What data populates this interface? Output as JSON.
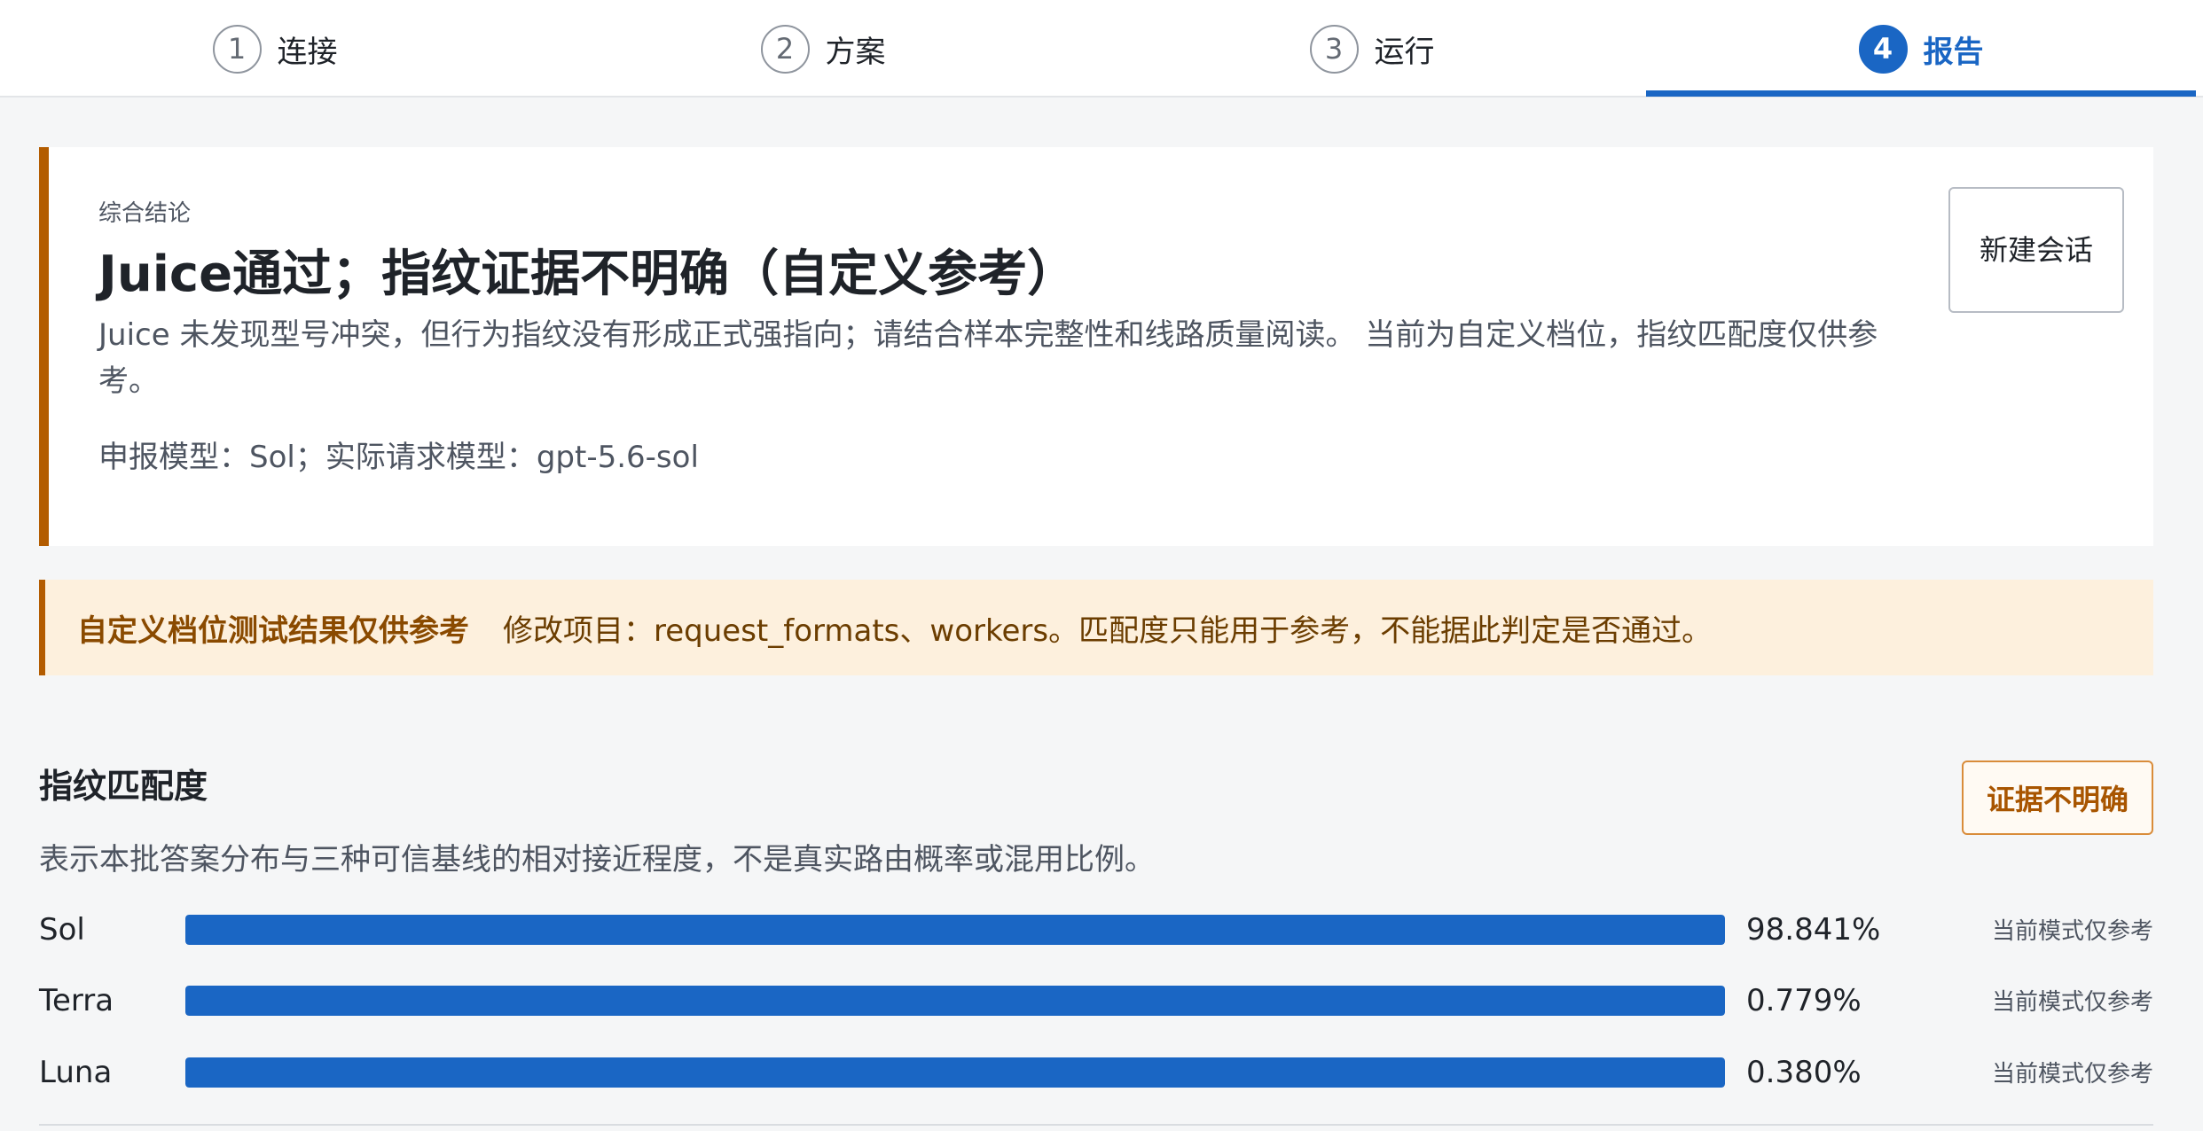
{
  "steps": [
    {
      "num": "1",
      "label": "连接"
    },
    {
      "num": "2",
      "label": "方案"
    },
    {
      "num": "3",
      "label": "运行"
    },
    {
      "num": "4",
      "label": "报告"
    }
  ],
  "active_step": 4,
  "summary": {
    "eyebrow": "综合结论",
    "title": "Juice通过；指纹证据不明确（自定义参考）",
    "description": "Juice 未发现型号冲突，但行为指纹没有形成正式强指向；请结合样本完整性和线路质量阅读。 当前为自定义档位，指纹匹配度仅供参考。",
    "models": "申报模型：Sol；实际请求模型：gpt-5.6-sol",
    "new_session_label": "新建会话"
  },
  "notice": {
    "title": "自定义档位测试结果仅供参考",
    "text": "修改项目：request_formats、workers。匹配度只能用于参考，不能据此判定是否通过。"
  },
  "fingerprint": {
    "title": "指纹匹配度",
    "badge": "证据不明确",
    "description": "表示本批答案分布与三种可信基线的相对接近程度，不是真实路由概率或混用比例。",
    "rows": [
      {
        "name": "Sol",
        "percent_label": "98.841%",
        "value": 98.841,
        "mode": "当前模式仅参考"
      },
      {
        "name": "Terra",
        "percent_label": "0.779%",
        "value": 0.779,
        "mode": "当前模式仅参考"
      },
      {
        "name": "Luna",
        "percent_label": "0.380%",
        "value": 0.38,
        "mode": "当前模式仅参考"
      }
    ]
  },
  "colors": {
    "accent": "#1a66c4",
    "warning": "#b35c00",
    "notice_bg": "#fdf0dd"
  }
}
